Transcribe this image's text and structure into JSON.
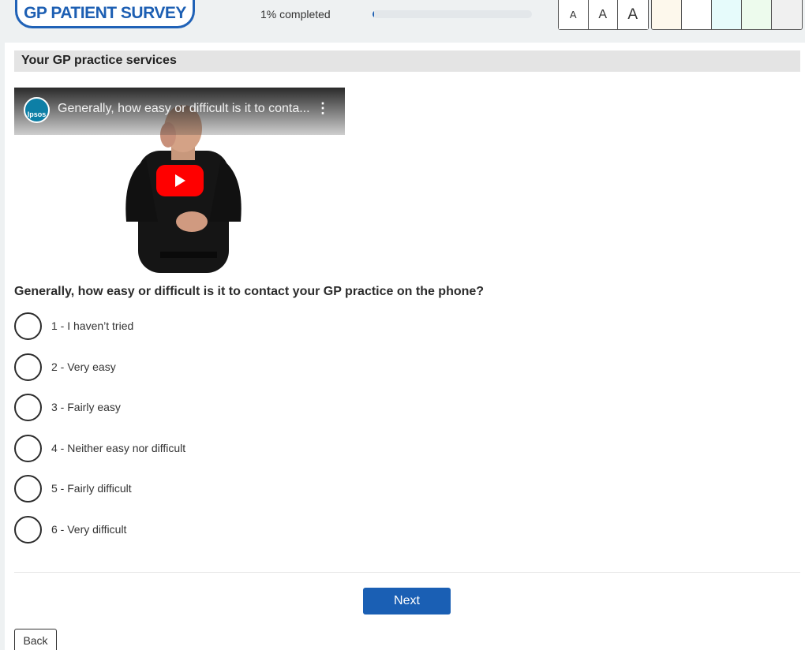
{
  "header": {
    "logo_text": "GP PATIENT SURVEY",
    "progress_label": "1% completed",
    "progress_percent": 1,
    "font_buttons": [
      "A",
      "A",
      "A"
    ],
    "colour_buttons": [
      "#fdf8ec",
      "#ffffff",
      "#e6fbfb",
      "#edfbed",
      "#f0f0f0"
    ]
  },
  "section": {
    "title": "Your GP practice services"
  },
  "video": {
    "channel": "Ipsos",
    "title": "Generally, how easy or difficult is it to conta..."
  },
  "question": {
    "text": "Generally, how easy or difficult is it to contact your GP practice on the phone?",
    "options": [
      "1 - I haven’t tried",
      "2 - Very easy",
      "3 - Fairly easy",
      "4 - Neither easy nor difficult",
      "5 - Fairly difficult",
      "6 - Very difficult"
    ]
  },
  "nav": {
    "next_label": "Next",
    "back_label": "Back"
  }
}
